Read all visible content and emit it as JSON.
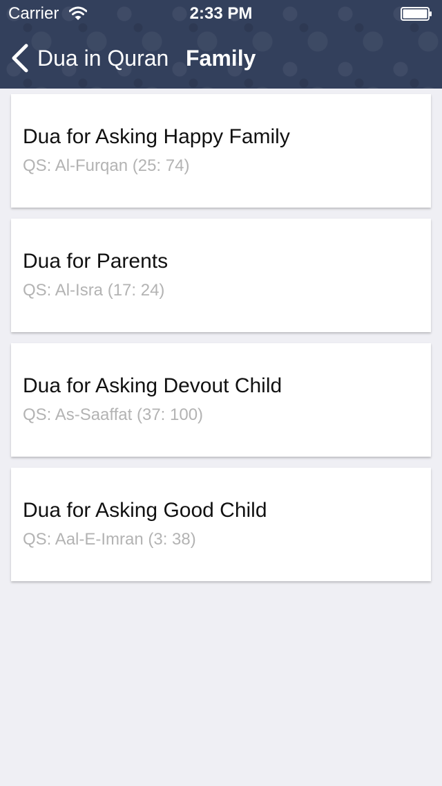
{
  "status_bar": {
    "carrier": "Carrier",
    "time": "2:33 PM",
    "icons": [
      "wifi-icon",
      "battery-icon"
    ]
  },
  "nav": {
    "back_label": "Dua in Quran",
    "title": "Family",
    "back_icon": "chevron-left-icon"
  },
  "colors": {
    "header_bg": "#33405c",
    "background": "#efeff4",
    "card_bg": "#ffffff",
    "title_text": "#111111",
    "subtitle_text": "#b3b3b3"
  },
  "duas": [
    {
      "title": "Dua for Asking Happy Family",
      "reference": "QS: Al-Furqan (25: 74)"
    },
    {
      "title": "Dua for Parents",
      "reference": "QS: Al-Isra (17: 24)"
    },
    {
      "title": "Dua for Asking Devout Child",
      "reference": "QS: As-Saaffat (37: 100)"
    },
    {
      "title": "Dua for Asking Good Child",
      "reference": "QS: Aal-E-Imran (3: 38)"
    }
  ]
}
